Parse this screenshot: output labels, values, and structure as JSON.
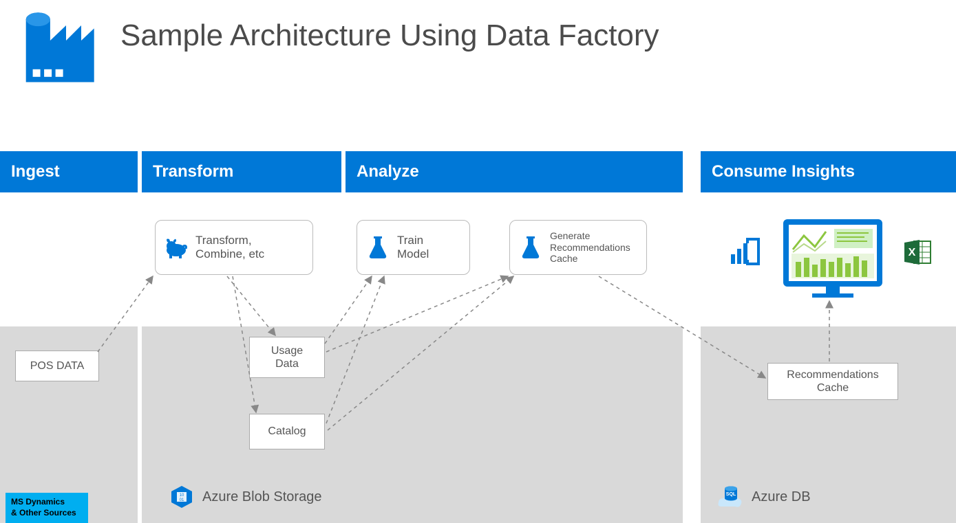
{
  "title": "Sample Architecture Using Data Factory",
  "stages": {
    "ingest": "Ingest",
    "transform": "Transform",
    "analyze": "Analyze",
    "consume": "Consume Insights"
  },
  "nodes": {
    "transform_combine": "Transform,\nCombine, etc",
    "train_model": "Train\nModel",
    "gen_reco": "Generate\nRecommendations\nCache",
    "pos_data": "POS DATA",
    "usage_data": "Usage\nData",
    "catalog": "Catalog",
    "reco_cache": "Recommendations\nCache"
  },
  "storage": {
    "blob": "Azure Blob Storage",
    "db": "Azure DB"
  },
  "badge": "MS Dynamics\n& Other Sources",
  "icons": {
    "factory": "factory-icon",
    "hadoop": "hadoop-icon",
    "flask": "flask-icon",
    "blob": "blob-storage-icon",
    "sql": "sql-db-icon",
    "powerbi": "powerbi-icon",
    "dashboard": "dashboard-monitor-icon",
    "excel": "excel-icon"
  }
}
